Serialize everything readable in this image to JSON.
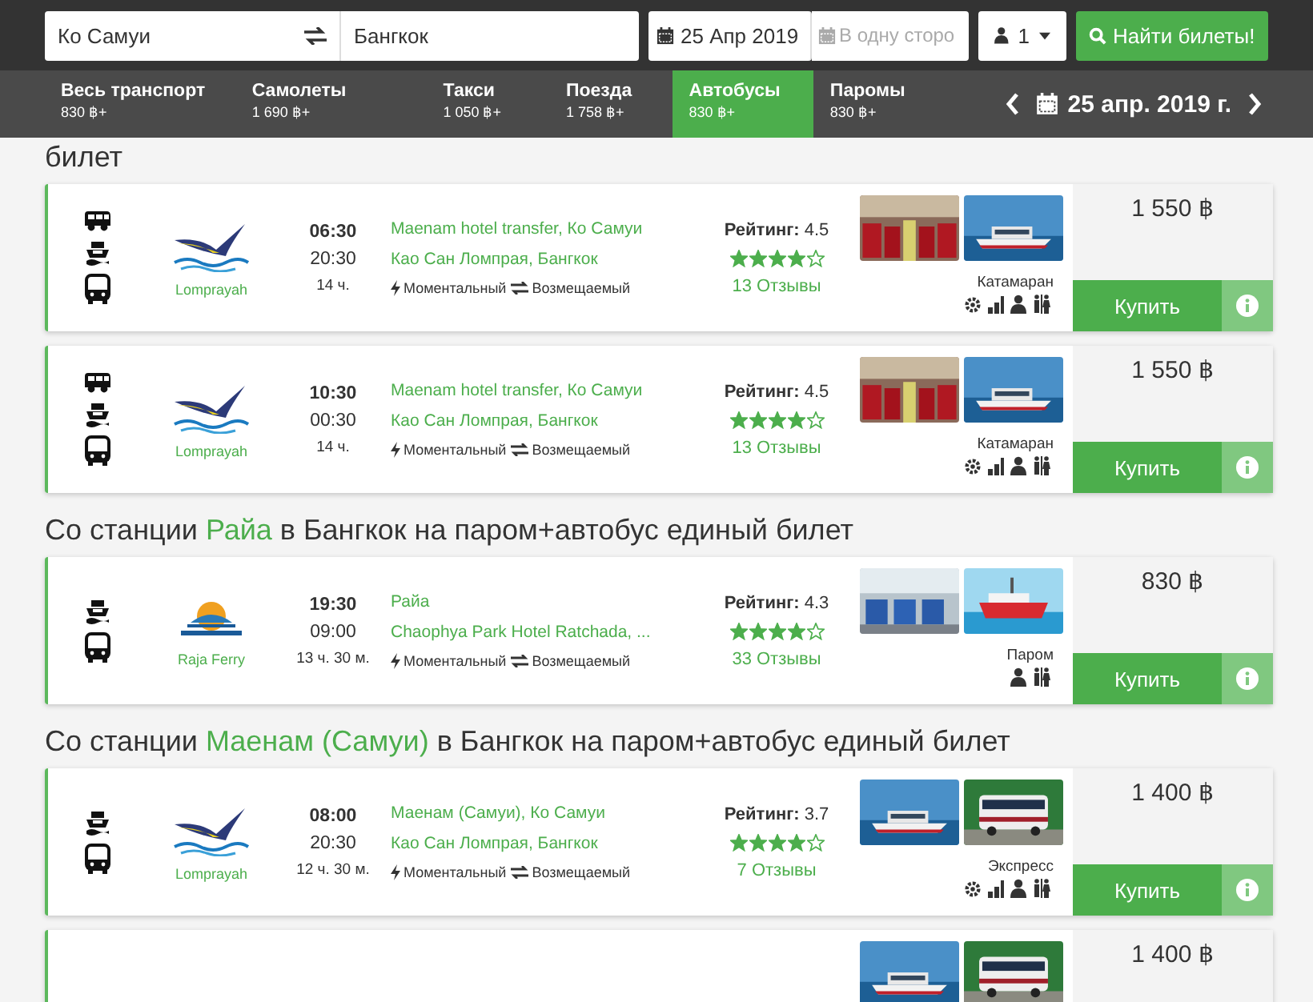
{
  "search": {
    "from": "Ко Самуи",
    "to": "Бангкок",
    "date": "25 Апр 2019",
    "return_placeholder": "В одну сторо",
    "passengers": "1",
    "button": "Найти билеты!"
  },
  "tabs": [
    {
      "label": "Весь транспорт",
      "price": "830 ฿+",
      "selected": false
    },
    {
      "label": "Самолеты",
      "price": "1 690 ฿+",
      "selected": false
    },
    {
      "label": "Такси",
      "price": "1 050 ฿+",
      "selected": false
    },
    {
      "label": "Поезда",
      "price": "1 758 ฿+",
      "selected": false
    },
    {
      "label": "Автобусы",
      "price": "830 ฿+",
      "selected": true
    },
    {
      "label": "Паромы",
      "price": "830 ฿+",
      "selected": false
    }
  ],
  "date_nav": {
    "date": "25 апр. 2019 г."
  },
  "sections": [
    {
      "heading": [
        {
          "text": "билет",
          "highlight": false
        }
      ],
      "results": [
        {
          "transport": [
            {
              "kind": "van"
            },
            {
              "kind": "boat"
            },
            {
              "kind": "bus"
            }
          ],
          "logo": {
            "kind": "bird"
          },
          "operator": "Lomprayah",
          "depart": "06:30",
          "arrive": "20:30",
          "duration": "14 ч.",
          "from": "Maenam hotel transfer, Ко Самуи",
          "to": "Као Сан Ломпрая, Бангкок",
          "features": [
            "Моментальный",
            "Возмещаемый"
          ],
          "rating_label": "Рейтинг:",
          "rating": "4.5",
          "stars": 4,
          "reviews": "13 Отзывы",
          "photos": [
            {
              "kind": "picture"
            },
            {
              "kind": "picture"
            }
          ],
          "vehicle": "Катамаран",
          "amenities": [
            {
              "kind": "gear"
            },
            {
              "kind": "signal"
            },
            {
              "kind": "person"
            },
            {
              "kind": "restroom"
            }
          ],
          "price": "1 550 ฿",
          "buy": "Купить"
        },
        {
          "transport": [
            {
              "kind": "van"
            },
            {
              "kind": "boat"
            },
            {
              "kind": "bus"
            }
          ],
          "logo": {
            "kind": "bird"
          },
          "operator": "Lomprayah",
          "depart": "10:30",
          "arrive": "00:30",
          "duration": "14 ч.",
          "from": "Maenam hotel transfer, Ко Самуи",
          "to": "Као Сан Ломпрая, Бангкок",
          "features": [
            "Моментальный",
            "Возмещаемый"
          ],
          "rating_label": "Рейтинг:",
          "rating": "4.5",
          "stars": 4,
          "reviews": "13 Отзывы",
          "photos": [
            {
              "kind": "picture"
            },
            {
              "kind": "picture"
            }
          ],
          "vehicle": "Катамаран",
          "amenities": [
            {
              "kind": "gear"
            },
            {
              "kind": "signal"
            },
            {
              "kind": "person"
            },
            {
              "kind": "restroom"
            }
          ],
          "price": "1 550 ฿",
          "buy": "Купить"
        }
      ]
    },
    {
      "heading": [
        {
          "text": "Со станции ",
          "highlight": false
        },
        {
          "text": "Райа",
          "highlight": true
        },
        {
          "text": " в Бангкок на паром+автобус единый билет",
          "highlight": false
        }
      ],
      "results": [
        {
          "transport": [
            {
              "kind": "boat"
            },
            {
              "kind": "bus"
            }
          ],
          "logo": {
            "kind": "sun"
          },
          "operator": "Raja Ferry",
          "depart": "19:30",
          "arrive": "09:00",
          "duration": "13 ч. 30 м.",
          "from": "Райа",
          "to": "Chaophya Park Hotel Ratchada, ...",
          "features": [
            "Моментальный",
            "Возмещаемый"
          ],
          "rating_label": "Рейтинг:",
          "rating": "4.3",
          "stars": 4,
          "reviews": "33 Отзывы",
          "photos": [
            {
              "kind": "picture"
            },
            {
              "kind": "picture"
            }
          ],
          "vehicle": "Паром",
          "amenities": [
            {
              "kind": "person"
            },
            {
              "kind": "restroom"
            }
          ],
          "price": "830 ฿",
          "buy": "Купить"
        }
      ]
    },
    {
      "heading": [
        {
          "text": "Со станции ",
          "highlight": false
        },
        {
          "text": "Маенам (Самуи)",
          "highlight": true
        },
        {
          "text": " в Бангкок на паром+автобус единый билет",
          "highlight": false
        }
      ],
      "results": [
        {
          "transport": [
            {
              "kind": "boat"
            },
            {
              "kind": "bus"
            }
          ],
          "logo": {
            "kind": "bird"
          },
          "operator": "Lomprayah",
          "depart": "08:00",
          "arrive": "20:30",
          "duration": "12 ч. 30 м.",
          "from": "Маенам (Самуи), Ко Самуи",
          "to": "Као Сан Ломпрая, Бангкок",
          "features": [
            "Моментальный",
            "Возмещаемый"
          ],
          "rating_label": "Рейтинг:",
          "rating": "3.7",
          "stars": 4,
          "reviews": "7 Отзывы",
          "photos": [
            {
              "kind": "picture"
            },
            {
              "kind": "picture"
            }
          ],
          "vehicle": "Экспресс",
          "amenities": [
            {
              "kind": "gear"
            },
            {
              "kind": "signal"
            },
            {
              "kind": "person"
            },
            {
              "kind": "restroom"
            }
          ],
          "price": "1 400 ฿",
          "buy": "Купить"
        },
        {
          "photos": [
            {
              "kind": "picture"
            },
            {
              "kind": "picture"
            }
          ],
          "price": "1 400 ฿"
        }
      ]
    }
  ]
}
